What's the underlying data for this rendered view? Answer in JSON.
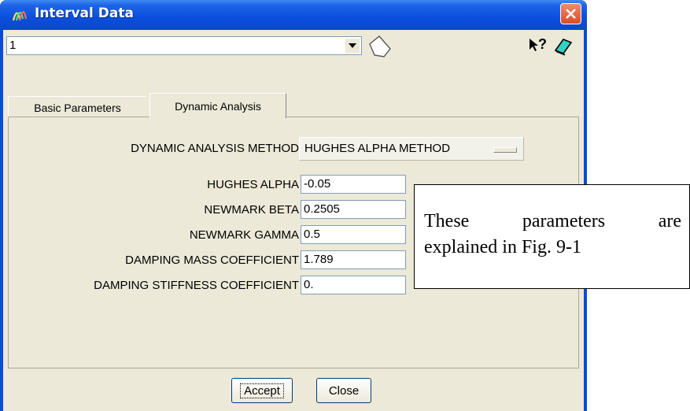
{
  "window": {
    "title": "Interval Data"
  },
  "toolbar": {
    "combo_value": "1",
    "help_symbol": "?"
  },
  "tabs": [
    {
      "label": "Basic Parameters"
    },
    {
      "label": "Dynamic Analysis"
    }
  ],
  "dynamic": {
    "method_label": "DYNAMIC ANALYSIS METHOD",
    "method_value": "HUGHES ALPHA METHOD",
    "fields": [
      {
        "label": "HUGHES ALPHA",
        "value": "-0.05"
      },
      {
        "label": "NEWMARK BETA",
        "value": "0.2505"
      },
      {
        "label": "NEWMARK GAMMA",
        "value": "0.5"
      },
      {
        "label": "DAMPING MASS COEFFICIENT",
        "value": "1.789"
      },
      {
        "label": "DAMPING STIFFNESS COEFFICIENT",
        "value": "0."
      }
    ]
  },
  "buttons": {
    "accept": "Accept",
    "close": "Close"
  },
  "note": {
    "line1_words": [
      "These",
      "parameters",
      "are"
    ],
    "line2": "explained in Fig. 9-1"
  }
}
